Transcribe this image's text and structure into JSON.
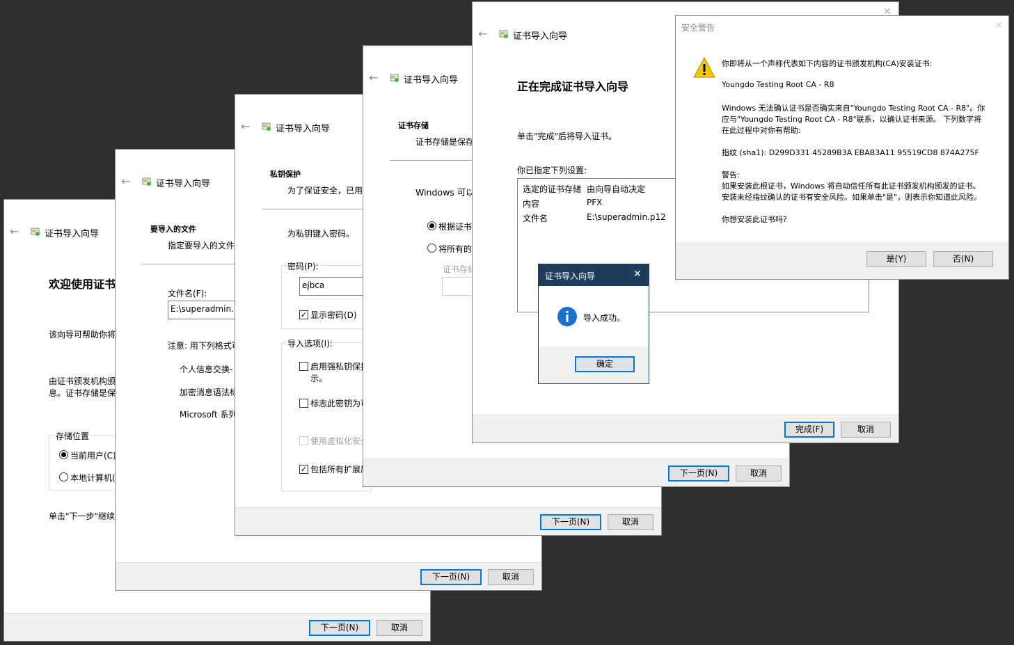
{
  "wizard_title": "证书导入向导",
  "win1": {
    "heading": "欢迎使用证书",
    "p1": "该向导可帮助你将",
    "p2a": "由证书颁发机构颁",
    "p2b": "息。证书存储是保",
    "store_group": "存储位置",
    "opt_current_user": "当前用户(C)",
    "opt_local_machine": "本地计算机(",
    "p3": "单击\"下一步\"继续",
    "next": "下一页(N)",
    "cancel": "取消"
  },
  "win2": {
    "section": "要导入的文件",
    "sub": "指定要导入的文件",
    "file_label": "文件名(F):",
    "file_value": "E:\\superadmin.p",
    "note": "注意: 用下列格式可",
    "fmt1": "个人信息交换-",
    "fmt2": "加密消息语法标",
    "fmt3": "Microsoft 系列",
    "next": "下一页(N)",
    "cancel": "取消"
  },
  "win3": {
    "section": "私钥保护",
    "sub": "为了保证安全，已用",
    "prompt": "为私钥键入密码。",
    "pwd_group": "密码(P):",
    "pwd_value": "ejbca",
    "show_pwd": "显示密码(D)",
    "opts_group": "导入选项(I):",
    "opt1a": "启用强私钥保护",
    "opt1b": "示。",
    "opt2": "标志此密钥为可",
    "opt3": "使用虚拟化安全",
    "opt4": "包括所有扩展属",
    "next": "下一页(N)",
    "cancel": "取消"
  },
  "win4": {
    "section": "证书存储",
    "sub": "证书存储是保存",
    "p1": "Windows 可以",
    "opt1": "根据证书",
    "opt2": "将所有的",
    "store_label": "证书存储",
    "next": "下一页(N)",
    "cancel": "取消"
  },
  "win5": {
    "heading": "正在完成证书导入向导",
    "p1": "单击\"完成\"后将导入证书。",
    "p2": "你已指定下列设置:",
    "rows": [
      {
        "k": "选定的证书存储",
        "v": "由向导自动决定"
      },
      {
        "k": "内容",
        "v": "PFX"
      },
      {
        "k": "文件名",
        "v": "E:\\superadmin.p12"
      }
    ],
    "finish": "完成(F)",
    "cancel": "取消"
  },
  "msgbox": {
    "title": "证书导入向导",
    "message": "导入成功。",
    "ok": "确定"
  },
  "warning": {
    "title": "安全警告",
    "l1": "你即将从一个声称代表如下内容的证书颁发机构(CA)安装证书:",
    "ca_name": "Youngdo Testing Root CA - R8",
    "l3a": "Windows 无法确认证书是否确实来自\"Youngdo Testing Root CA - R8\"。你",
    "l3b": "应与\"Youngdo Testing Root CA - R8\"联系，以确认证书来源。 下列数字将",
    "l3c": "在此过程中对你有帮助:",
    "thumb": "指纹 (sha1): D299D331 45289B3A EBAB3A11 95519CD8 874A275F",
    "warn_label": "警告:",
    "w1": "如果安装此根证书，Windows 将自动信任所有此证书颁发机构颁发的证书。",
    "w2": "安装未经指纹确认的证书有安全风险。如果单击\"是\"，则表示你知道此风险。",
    "question": "你想安装此证书吗?",
    "yes": "是(Y)",
    "no": "否(N)"
  }
}
